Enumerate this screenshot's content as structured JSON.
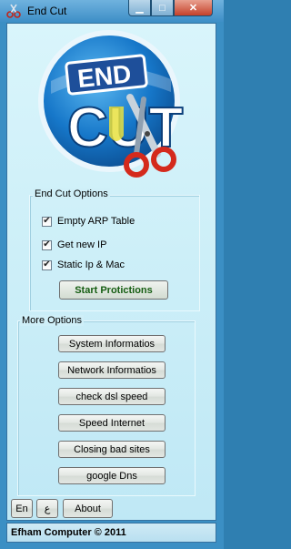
{
  "window": {
    "title": "End Cut",
    "controls": [
      "minimize",
      "maximize",
      "close"
    ]
  },
  "logo": {
    "text_top": "END",
    "text_bottom": "CUT",
    "icon": "scissors-icon"
  },
  "options_group": {
    "legend": "End Cut Options",
    "checkboxes": [
      {
        "label": "Empty ARP Table",
        "checked": true
      },
      {
        "label": "Get new IP",
        "checked": true
      },
      {
        "label": "Static Ip & Mac",
        "checked": true
      }
    ],
    "start_button": "Start Protictions"
  },
  "more_group": {
    "legend": "More Options",
    "buttons": [
      "System Informatios",
      "Network Informatios",
      "check dsl speed",
      "Speed Internet",
      "Closing bad sites",
      "google Dns"
    ]
  },
  "footer": {
    "lang_en": "En",
    "lang_ar": "ع",
    "about": "About"
  },
  "status": "Efham Computer © 2011",
  "colors": {
    "titlebar": "#3e8fc7",
    "client_bg": "#cfeff8",
    "start_text": "#155d12",
    "logo_blue": "#1677c9",
    "logo_yellow": "#e8e040",
    "scissors_red": "#d42a1c"
  }
}
